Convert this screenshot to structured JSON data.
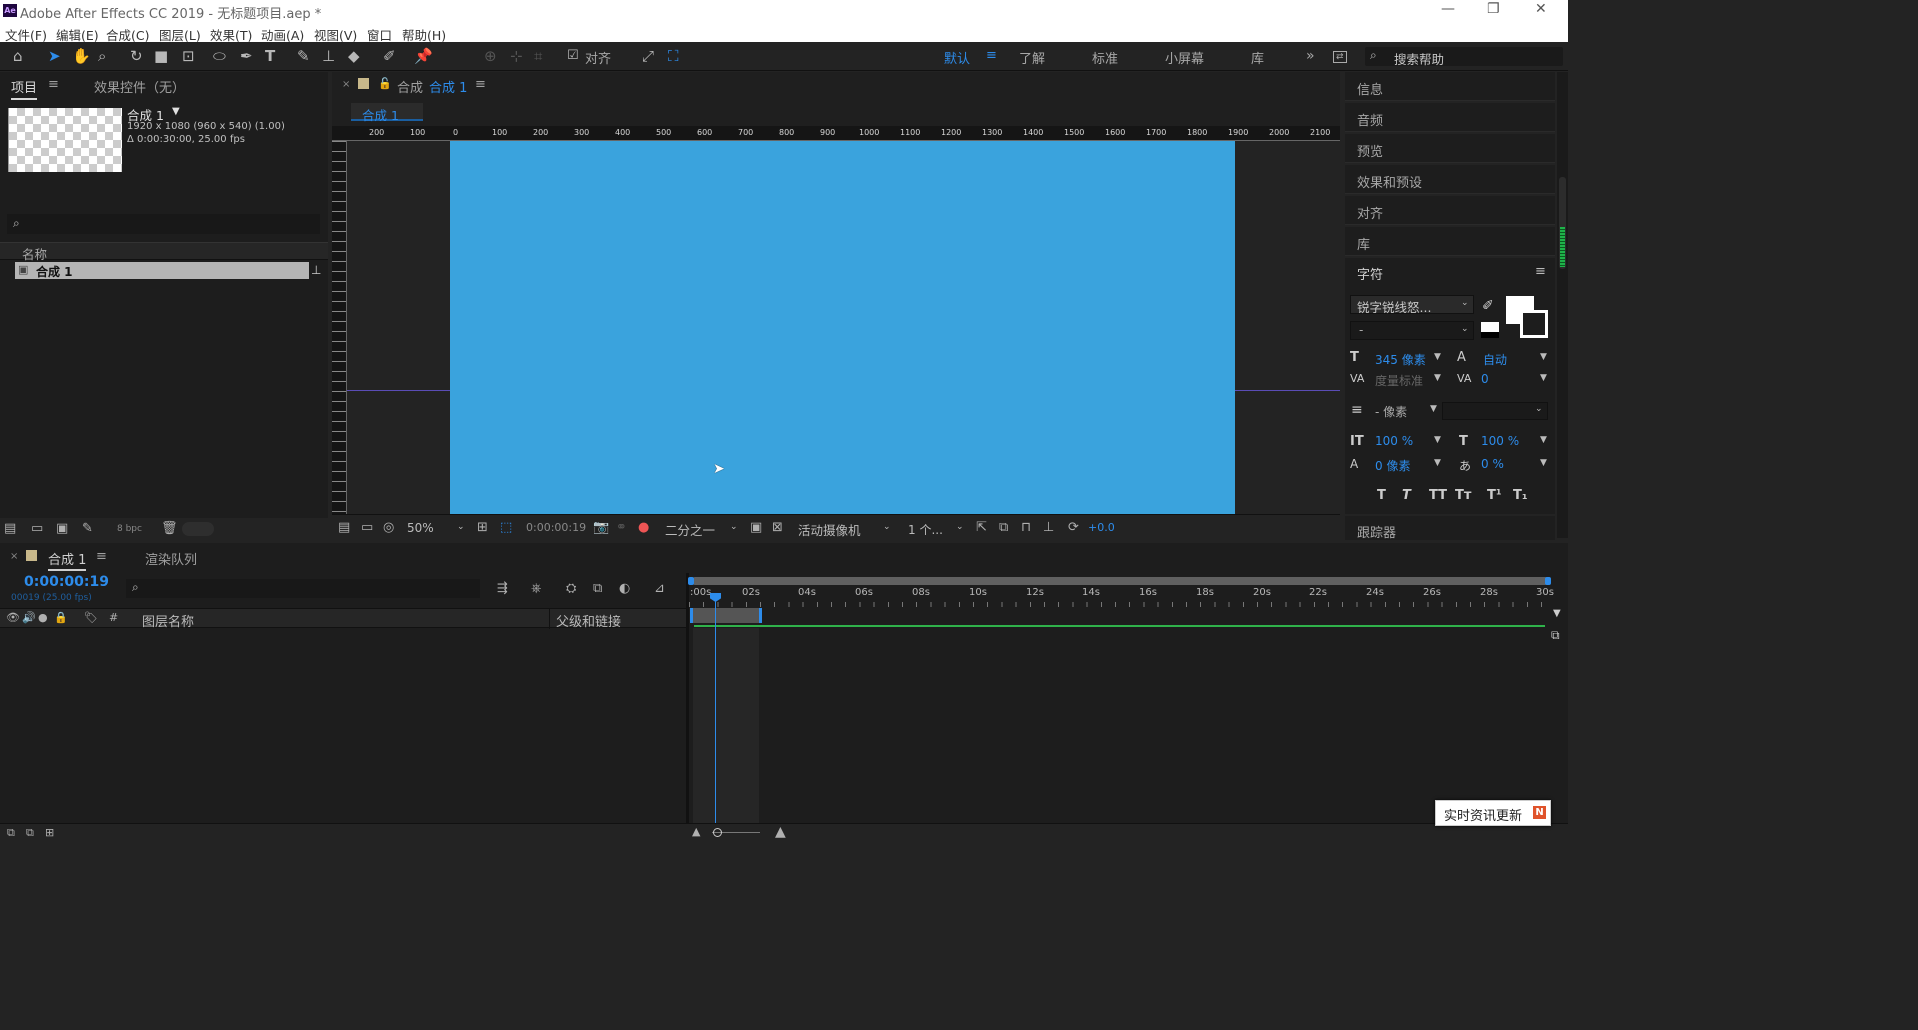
{
  "window": {
    "title": "Adobe After Effects CC 2019 - 无标题项目.aep *",
    "app_icon": "Ae"
  },
  "menu": [
    "文件(F)",
    "编辑(E)",
    "合成(C)",
    "图层(L)",
    "效果(T)",
    "动画(A)",
    "视图(V)",
    "窗口",
    "帮助(H)"
  ],
  "toolbar": {
    "align_label": "对齐",
    "workspaces": [
      "默认",
      "了解",
      "标准",
      "小屏幕",
      "库"
    ],
    "search_placeholder": "搜索帮助"
  },
  "project": {
    "tab": "项目",
    "effects_tab": "效果控件（无）",
    "comp_name": "合成 1",
    "comp_info1": "1920 x 1080  (960 x 540) (1.00)",
    "comp_info2": "Δ 0:00:30:00, 25.00 fps",
    "col_name": "名称",
    "item": "合成 1",
    "bpc": "8 bpc"
  },
  "viewer": {
    "tab_prefix": "合成",
    "tab_name": "合成 1",
    "sub_tab": "合成 1",
    "zoom": "50%",
    "timecode": "0:00:00:19",
    "resolution": "二分之一",
    "camera": "活动摄像机",
    "views": "1 个...",
    "exposure": "+0.0",
    "bg_color": "#3aa3dd",
    "ruler_labels": [
      "200",
      "100",
      "0",
      "100",
      "200",
      "300",
      "400",
      "500",
      "600",
      "700",
      "800",
      "900",
      "1000",
      "1100",
      "1200",
      "1300",
      "1400",
      "1500",
      "1600",
      "1700",
      "1800",
      "1900",
      "2000",
      "2100"
    ]
  },
  "side": {
    "items": [
      "信息",
      "音频",
      "预览",
      "效果和预设",
      "对齐",
      "库"
    ],
    "char_title": "字符",
    "font": "锐字锐线怒...",
    "style": "-",
    "size": "345 像素",
    "leading": "自动",
    "kerning": "度量标准",
    "tracking": "0",
    "stroke": "- 像素",
    "vscale": "100 %",
    "hscale": "100 %",
    "baseline": "0 像素",
    "tsume": "0 %",
    "tracker": "跟踪器"
  },
  "timeline": {
    "tab": "合成 1",
    "render_tab": "渲染队列",
    "timecode": "0:00:00:19",
    "frame_info": "00019 (25.00 fps)",
    "col_layer": "图层名称",
    "col_parent": "父级和链接",
    "ticks": [
      ":00s",
      "02s",
      "04s",
      "06s",
      "08s",
      "10s",
      "12s",
      "14s",
      "16s",
      "18s",
      "20s",
      "22s",
      "24s",
      "26s",
      "28s",
      "30s"
    ]
  },
  "notice": {
    "text": "实时资讯更新"
  }
}
